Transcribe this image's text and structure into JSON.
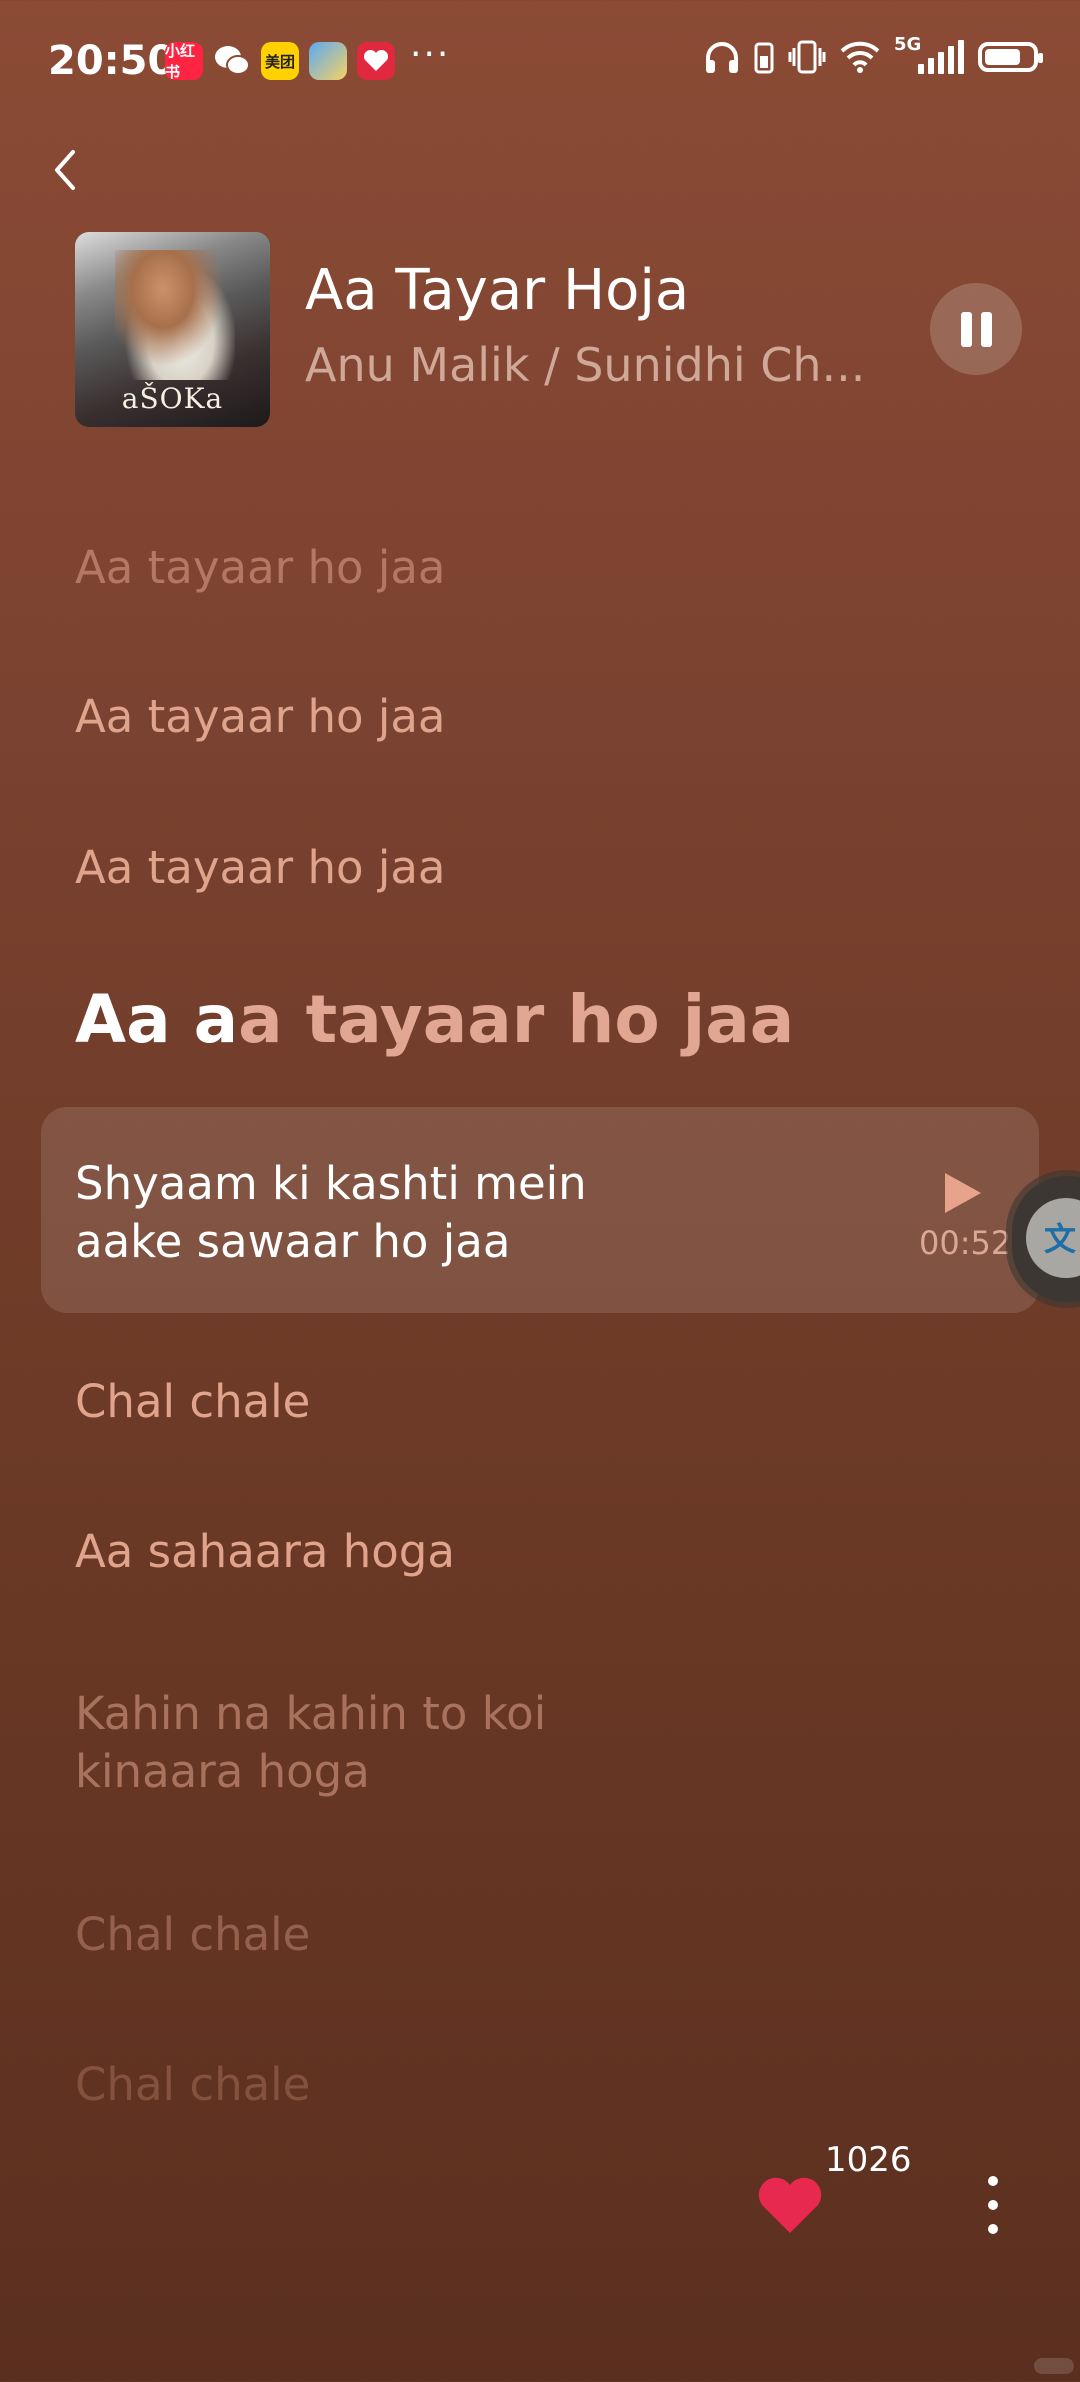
{
  "status_bar": {
    "time": "20:50",
    "apps": [
      {
        "icon": "xiaohongshu-icon",
        "label": "小红书"
      },
      {
        "icon": "wechat-icon",
        "label": ""
      },
      {
        "icon": "meituan-icon",
        "label": "美团"
      },
      {
        "icon": "weather-icon",
        "label": ""
      },
      {
        "icon": "heart-app-icon",
        "label": ""
      }
    ],
    "more": "···",
    "network": "5G",
    "battery_level": 0.8
  },
  "player": {
    "song_title": "Aa Tayar Hoja",
    "artist": "Anu Malik / Sunidhi Ch...",
    "album_art_text": "aŠOKa",
    "is_playing": true
  },
  "lyrics": {
    "lines": [
      {
        "text": "Aa tayaar ho jaa",
        "state": "past"
      },
      {
        "text": "Aa tayaar ho jaa",
        "state": "past"
      },
      {
        "text": "Aa tayaar ho jaa",
        "state": "past"
      },
      {
        "sung": "Aa a",
        "unsung": "a tayaar ho jaa",
        "state": "current"
      },
      {
        "line1": "Shyaam ki kashti mein",
        "line2": "aake sawaar ho jaa",
        "time": "00:52",
        "state": "selected"
      },
      {
        "text": "Chal chale",
        "state": "upcoming"
      },
      {
        "text": "Aa sahaara hoga",
        "state": "upcoming"
      },
      {
        "line1": "Kahin na kahin to koi",
        "line2": "kinaara hoga",
        "state": "upcoming"
      },
      {
        "text": "Chal chale",
        "state": "upcoming"
      },
      {
        "text": "Chal chale",
        "state": "upcoming"
      }
    ]
  },
  "controls": {
    "like_count": "1026",
    "accent_color": "#e8294f",
    "float_icon_text": "文"
  }
}
